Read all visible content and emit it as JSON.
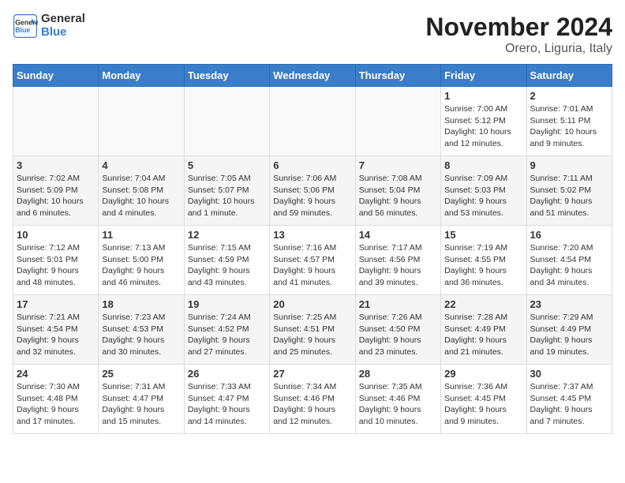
{
  "logo": {
    "text_general": "General",
    "text_blue": "Blue"
  },
  "title": "November 2024",
  "subtitle": "Orero, Liguria, Italy",
  "weekdays": [
    "Sunday",
    "Monday",
    "Tuesday",
    "Wednesday",
    "Thursday",
    "Friday",
    "Saturday"
  ],
  "weeks": [
    [
      {
        "day": "",
        "info": ""
      },
      {
        "day": "",
        "info": ""
      },
      {
        "day": "",
        "info": ""
      },
      {
        "day": "",
        "info": ""
      },
      {
        "day": "",
        "info": ""
      },
      {
        "day": "1",
        "info": "Sunrise: 7:00 AM\nSunset: 5:12 PM\nDaylight: 10 hours\nand 12 minutes."
      },
      {
        "day": "2",
        "info": "Sunrise: 7:01 AM\nSunset: 5:11 PM\nDaylight: 10 hours\nand 9 minutes."
      }
    ],
    [
      {
        "day": "3",
        "info": "Sunrise: 7:02 AM\nSunset: 5:09 PM\nDaylight: 10 hours\nand 6 minutes."
      },
      {
        "day": "4",
        "info": "Sunrise: 7:04 AM\nSunset: 5:08 PM\nDaylight: 10 hours\nand 4 minutes."
      },
      {
        "day": "5",
        "info": "Sunrise: 7:05 AM\nSunset: 5:07 PM\nDaylight: 10 hours\nand 1 minute."
      },
      {
        "day": "6",
        "info": "Sunrise: 7:06 AM\nSunset: 5:06 PM\nDaylight: 9 hours\nand 59 minutes."
      },
      {
        "day": "7",
        "info": "Sunrise: 7:08 AM\nSunset: 5:04 PM\nDaylight: 9 hours\nand 56 minutes."
      },
      {
        "day": "8",
        "info": "Sunrise: 7:09 AM\nSunset: 5:03 PM\nDaylight: 9 hours\nand 53 minutes."
      },
      {
        "day": "9",
        "info": "Sunrise: 7:11 AM\nSunset: 5:02 PM\nDaylight: 9 hours\nand 51 minutes."
      }
    ],
    [
      {
        "day": "10",
        "info": "Sunrise: 7:12 AM\nSunset: 5:01 PM\nDaylight: 9 hours\nand 48 minutes."
      },
      {
        "day": "11",
        "info": "Sunrise: 7:13 AM\nSunset: 5:00 PM\nDaylight: 9 hours\nand 46 minutes."
      },
      {
        "day": "12",
        "info": "Sunrise: 7:15 AM\nSunset: 4:59 PM\nDaylight: 9 hours\nand 43 minutes."
      },
      {
        "day": "13",
        "info": "Sunrise: 7:16 AM\nSunset: 4:57 PM\nDaylight: 9 hours\nand 41 minutes."
      },
      {
        "day": "14",
        "info": "Sunrise: 7:17 AM\nSunset: 4:56 PM\nDaylight: 9 hours\nand 39 minutes."
      },
      {
        "day": "15",
        "info": "Sunrise: 7:19 AM\nSunset: 4:55 PM\nDaylight: 9 hours\nand 36 minutes."
      },
      {
        "day": "16",
        "info": "Sunrise: 7:20 AM\nSunset: 4:54 PM\nDaylight: 9 hours\nand 34 minutes."
      }
    ],
    [
      {
        "day": "17",
        "info": "Sunrise: 7:21 AM\nSunset: 4:54 PM\nDaylight: 9 hours\nand 32 minutes."
      },
      {
        "day": "18",
        "info": "Sunrise: 7:23 AM\nSunset: 4:53 PM\nDaylight: 9 hours\nand 30 minutes."
      },
      {
        "day": "19",
        "info": "Sunrise: 7:24 AM\nSunset: 4:52 PM\nDaylight: 9 hours\nand 27 minutes."
      },
      {
        "day": "20",
        "info": "Sunrise: 7:25 AM\nSunset: 4:51 PM\nDaylight: 9 hours\nand 25 minutes."
      },
      {
        "day": "21",
        "info": "Sunrise: 7:26 AM\nSunset: 4:50 PM\nDaylight: 9 hours\nand 23 minutes."
      },
      {
        "day": "22",
        "info": "Sunrise: 7:28 AM\nSunset: 4:49 PM\nDaylight: 9 hours\nand 21 minutes."
      },
      {
        "day": "23",
        "info": "Sunrise: 7:29 AM\nSunset: 4:49 PM\nDaylight: 9 hours\nand 19 minutes."
      }
    ],
    [
      {
        "day": "24",
        "info": "Sunrise: 7:30 AM\nSunset: 4:48 PM\nDaylight: 9 hours\nand 17 minutes."
      },
      {
        "day": "25",
        "info": "Sunrise: 7:31 AM\nSunset: 4:47 PM\nDaylight: 9 hours\nand 15 minutes."
      },
      {
        "day": "26",
        "info": "Sunrise: 7:33 AM\nSunset: 4:47 PM\nDaylight: 9 hours\nand 14 minutes."
      },
      {
        "day": "27",
        "info": "Sunrise: 7:34 AM\nSunset: 4:46 PM\nDaylight: 9 hours\nand 12 minutes."
      },
      {
        "day": "28",
        "info": "Sunrise: 7:35 AM\nSunset: 4:46 PM\nDaylight: 9 hours\nand 10 minutes."
      },
      {
        "day": "29",
        "info": "Sunrise: 7:36 AM\nSunset: 4:45 PM\nDaylight: 9 hours\nand 9 minutes."
      },
      {
        "day": "30",
        "info": "Sunrise: 7:37 AM\nSunset: 4:45 PM\nDaylight: 9 hours\nand 7 minutes."
      }
    ]
  ]
}
